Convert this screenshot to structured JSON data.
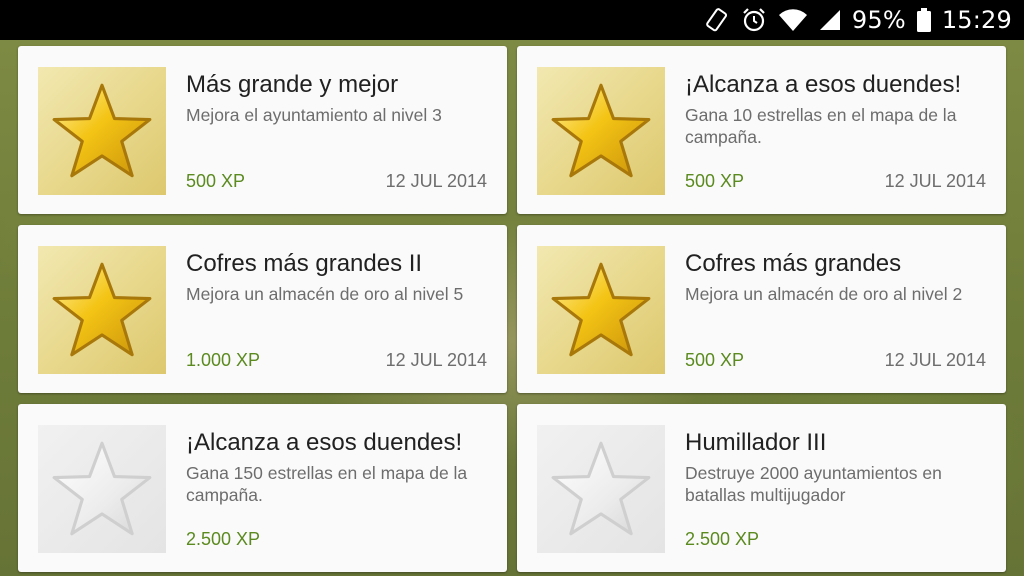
{
  "status_bar": {
    "battery_text": "95%",
    "clock": "15:29"
  },
  "colors": {
    "xp": "#5b8a1f",
    "star_gold": "#f4c415",
    "star_locked": "#e6e6e6"
  },
  "achievements": [
    {
      "title": "Más grande y mejor",
      "description": "Mejora el ayuntamiento al nivel 3",
      "xp": "500 XP",
      "date": "12 JUL 2014",
      "icon": "gold-star-icon",
      "unlocked": true
    },
    {
      "title": "¡Alcanza a esos duendes!",
      "description": "Gana 10 estrellas en el mapa de la campaña.",
      "xp": "500 XP",
      "date": "12 JUL 2014",
      "icon": "gold-star-icon",
      "unlocked": true
    },
    {
      "title": "Cofres más grandes II",
      "description": "Mejora un almacén de oro al nivel 5",
      "xp": "1.000 XP",
      "date": "12 JUL 2014",
      "icon": "gold-star-icon",
      "unlocked": true
    },
    {
      "title": "Cofres más grandes",
      "description": "Mejora un almacén de oro al nivel 2",
      "xp": "500 XP",
      "date": "12 JUL 2014",
      "icon": "gold-star-icon",
      "unlocked": true
    },
    {
      "title": "¡Alcanza a esos duendes!",
      "description": "Gana 150 estrellas en el mapa de la campaña.",
      "xp": "2.500 XP",
      "date": "",
      "icon": "locked-star-icon",
      "unlocked": false
    },
    {
      "title": "Humillador III",
      "description": "Destruye 2000 ayuntamientos en batallas multijugador",
      "xp": "2.500 XP",
      "date": "",
      "icon": "locked-star-icon",
      "unlocked": false
    }
  ]
}
